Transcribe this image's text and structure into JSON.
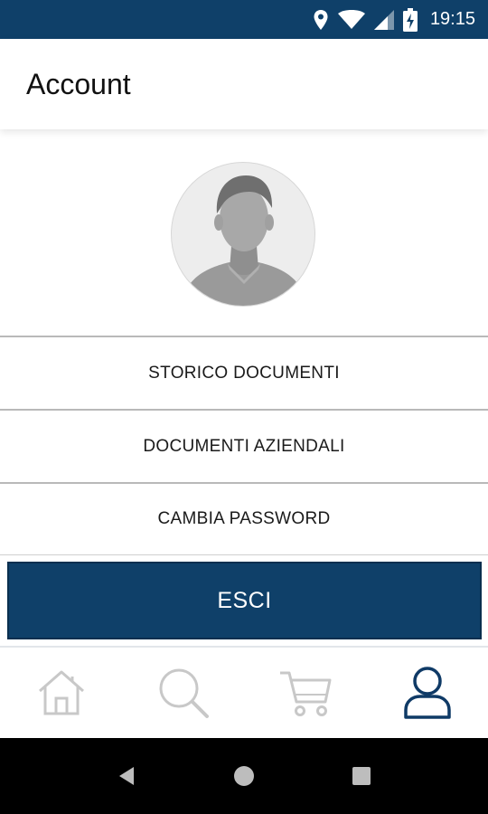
{
  "status_bar": {
    "time": "19:15",
    "icons": [
      "location-icon",
      "wifi-icon",
      "signal-icon",
      "battery-charging-icon"
    ]
  },
  "header": {
    "title": "Account"
  },
  "profile": {
    "avatar_icon": "default-user-avatar"
  },
  "menu": {
    "items": [
      {
        "label": "STORICO DOCUMENTI"
      },
      {
        "label": "DOCUMENTI AZIENDALI"
      },
      {
        "label": "CAMBIA PASSWORD"
      }
    ],
    "logout_label": "ESCI"
  },
  "bottom_nav": {
    "items": [
      {
        "icon": "home-icon",
        "active": false
      },
      {
        "icon": "search-icon",
        "active": false
      },
      {
        "icon": "cart-icon",
        "active": false
      },
      {
        "icon": "user-icon",
        "active": true
      }
    ]
  },
  "system_nav": {
    "buttons": [
      "back-icon",
      "home-circle-icon",
      "recents-icon"
    ]
  },
  "colors": {
    "primary": "#0f4069",
    "inactive_icon": "#c8c8c8",
    "active_icon": "#0f3a66"
  }
}
